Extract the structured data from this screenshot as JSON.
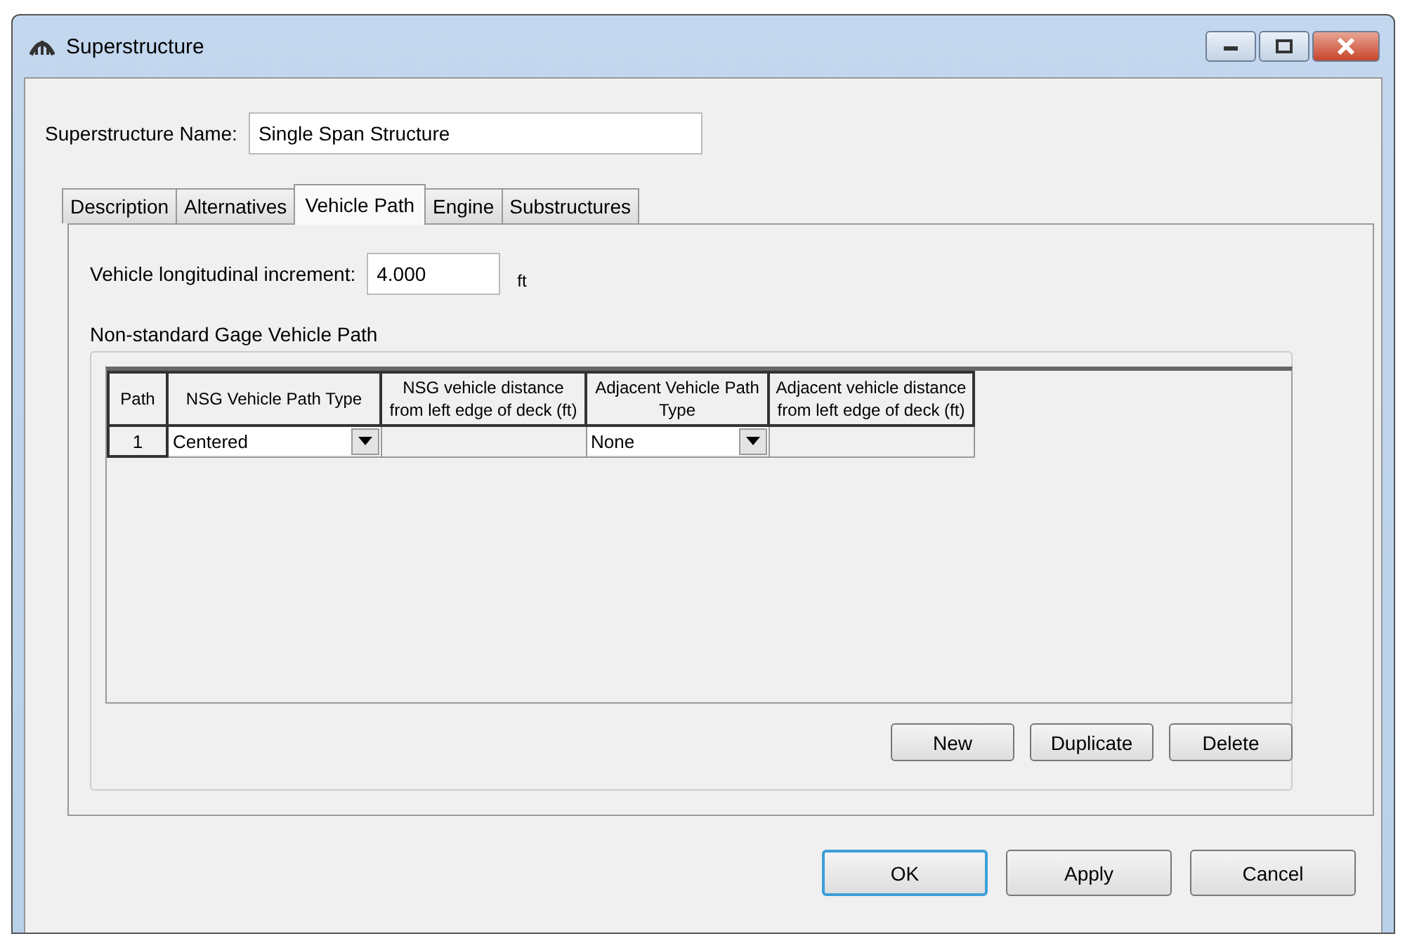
{
  "window": {
    "title": "Superstructure"
  },
  "name_field": {
    "label": "Superstructure Name:",
    "value": "Single Span Structure"
  },
  "tabs": [
    {
      "label": "Description",
      "selected": false
    },
    {
      "label": "Alternatives",
      "selected": false
    },
    {
      "label": "Vehicle Path",
      "selected": true
    },
    {
      "label": "Engine",
      "selected": false
    },
    {
      "label": "Substructures",
      "selected": false
    }
  ],
  "increment": {
    "label": "Vehicle longitudinal increment:",
    "value": "4.000",
    "unit": "ft"
  },
  "group": {
    "title": "Non-standard Gage Vehicle Path",
    "table": {
      "columns": [
        "Path",
        "NSG Vehicle Path Type",
        "NSG vehicle distance from left edge of deck (ft)",
        "Adjacent Vehicle Path Type",
        "Adjacent vehicle distance from left edge of deck (ft)"
      ],
      "rows": [
        [
          {
            "kind": "header",
            "text": "1"
          },
          {
            "kind": "dropdown",
            "text": "Centered"
          },
          {
            "kind": "blank"
          },
          {
            "kind": "dropdown",
            "text": "None"
          },
          {
            "kind": "blank"
          }
        ]
      ]
    },
    "buttons": [
      {
        "label": "New",
        "default": false
      },
      {
        "label": "Duplicate",
        "default": false
      },
      {
        "label": "Delete",
        "default": false
      }
    ]
  },
  "buttons": [
    {
      "label": "OK",
      "default": true
    },
    {
      "label": "Apply",
      "default": false
    },
    {
      "label": "Cancel",
      "default": false
    }
  ]
}
